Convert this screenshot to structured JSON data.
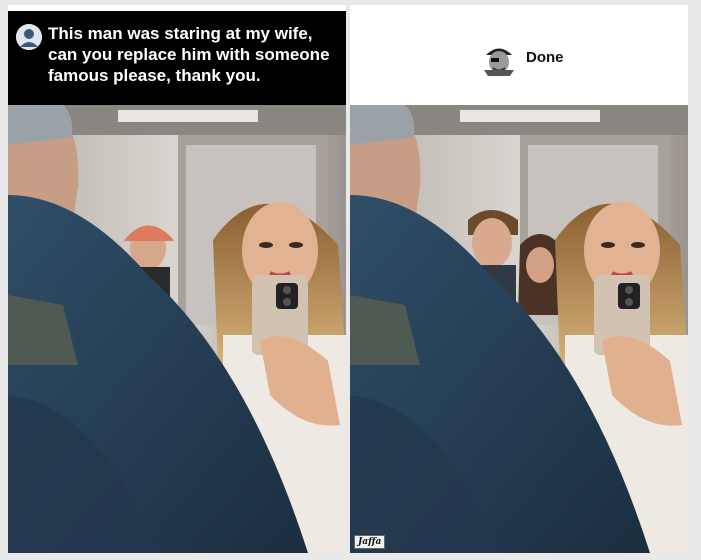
{
  "post_left": {
    "caption": "This man was staring at my wife, can you replace him with someone famous please, thank you."
  },
  "post_right": {
    "caption": "Done",
    "watermark": "Jaffa"
  },
  "icons": {
    "left_avatar": "user-avatar-icon",
    "right_avatar": "pirate-avatar-icon"
  },
  "colors": {
    "caption_bar": "#000000",
    "jacket": "#2c4a63",
    "cap": "#e07a5f"
  }
}
